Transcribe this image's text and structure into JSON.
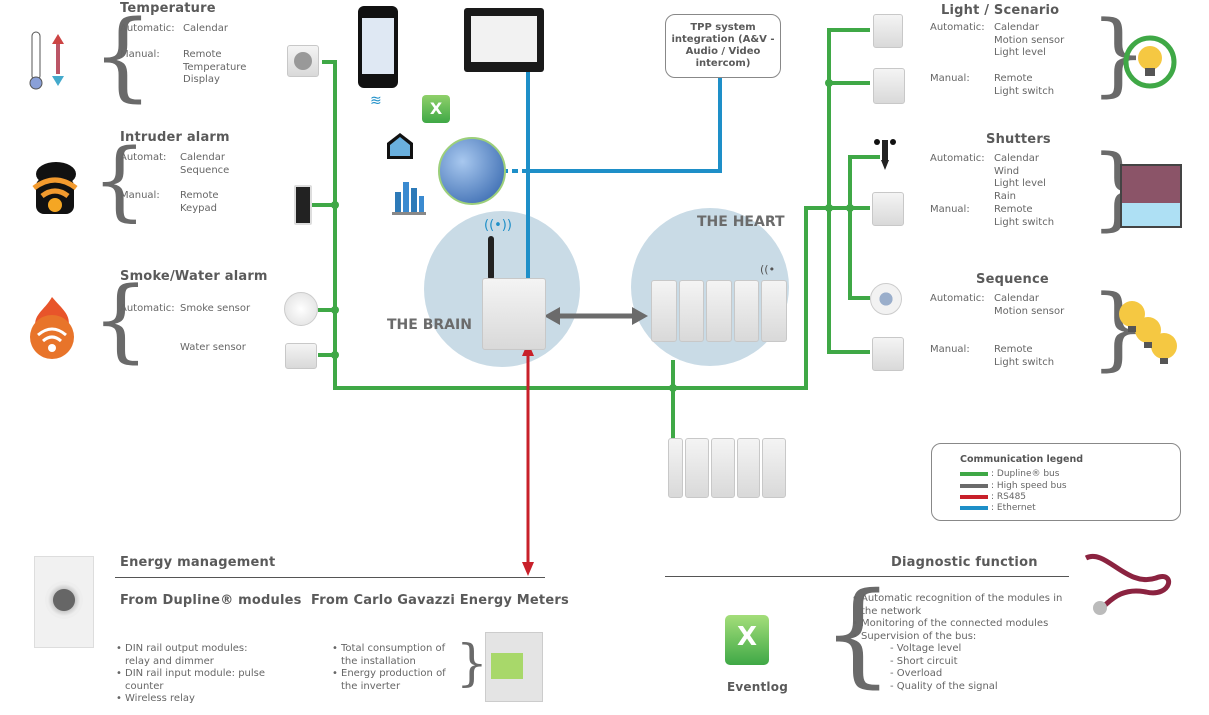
{
  "left_sections": [
    {
      "title": "Temperature",
      "rows": [
        {
          "label": "Automatic:",
          "values": [
            "Calendar"
          ]
        },
        {
          "label": "Manual:",
          "values": [
            "Remote",
            "Temperature",
            "Display"
          ]
        }
      ],
      "icon": "thermometer-icon"
    },
    {
      "title": "Intruder alarm",
      "rows": [
        {
          "label": "Automat:",
          "values": [
            "Calendar",
            "Sequence"
          ]
        },
        {
          "label": "Manual:",
          "values": [
            "Remote",
            "Keypad"
          ]
        }
      ],
      "icon": "intruder-icon"
    },
    {
      "title": "Smoke/Water alarm",
      "rows": [
        {
          "label": "Automatic:",
          "values": [
            "Smoke sensor"
          ]
        },
        {
          "label": "",
          "values": [
            "Water sensor"
          ]
        }
      ],
      "icon": "fire-alarm-icon"
    }
  ],
  "right_sections": [
    {
      "title": "Light / Scenario",
      "rows": [
        {
          "label": "Automatic:",
          "values": [
            "Calendar",
            "Motion sensor",
            "Light level"
          ]
        },
        {
          "label": "Manual:",
          "values": [
            "Remote",
            "Light switch"
          ]
        }
      ],
      "icon": "light-bulb-cycle-icon"
    },
    {
      "title": "Shutters",
      "rows": [
        {
          "label": "Automatic:",
          "values": [
            "Calendar",
            "Wind",
            "Light level",
            "Rain"
          ]
        },
        {
          "label": "Manual:",
          "values": [
            "Remote",
            "Light switch"
          ]
        }
      ],
      "icon": "window-shutter-icon"
    },
    {
      "title": "Sequence",
      "rows": [
        {
          "label": "Automatic:",
          "values": [
            "Calendar",
            "Motion sensor"
          ]
        },
        {
          "label": "Manual:",
          "values": [
            "Remote",
            "Light switch"
          ]
        }
      ],
      "icon": "bulbs-sequence-icon"
    }
  ],
  "center": {
    "brain_label": "THE BRAIN",
    "heart_label": "THE HEART",
    "tpp_box": "TPP system integration (A&V - Audio / Video intercom)"
  },
  "legend": {
    "title": "Communication legend",
    "items": [
      {
        "label": ": Dupline® bus",
        "color": "#3fa846"
      },
      {
        "label": ": High speed bus",
        "color": "#6b6b6b"
      },
      {
        "label": ": RS485",
        "color": "#c8202a"
      },
      {
        "label": ": Ethernet",
        "color": "#1e8fc8"
      }
    ]
  },
  "energy": {
    "title": "Energy management",
    "dupline_heading": "From Dupline® modules",
    "dupline_items": [
      "DIN rail output modules: relay and dimmer",
      "DIN rail input module: pulse counter",
      "Wireless relay"
    ],
    "meters_heading": "From Carlo Gavazzi Energy Meters",
    "meters_items": [
      "Total consumption of the installation",
      "Energy production of the inverter"
    ]
  },
  "diagnostic": {
    "title": "Diagnostic function",
    "eventlog_label": "Eventlog",
    "items": [
      "Automatic recognition of the modules in the network",
      "Monitoring of the connected modules",
      "Supervision of the bus:"
    ],
    "sub_items": [
      "- Voltage level",
      "- Short circuit",
      "- Overload",
      "- Quality of the signal"
    ]
  },
  "colors": {
    "dupline": "#3fa846",
    "highspeed": "#6b6b6b",
    "rs485": "#c8202a",
    "ethernet": "#1e8fc8",
    "bubble": "#c9dbe6"
  }
}
